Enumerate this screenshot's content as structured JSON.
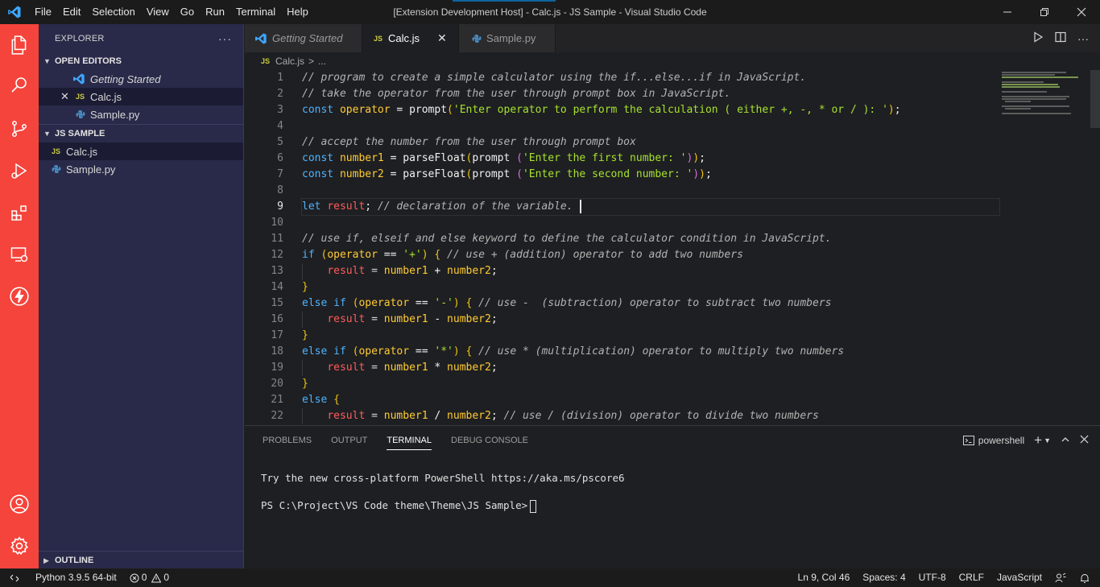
{
  "titlebar": {
    "title": "[Extension Development Host] - Calc.js - JS Sample - Visual Studio Code",
    "menu": [
      "File",
      "Edit",
      "Selection",
      "View",
      "Go",
      "Run",
      "Terminal",
      "Help"
    ]
  },
  "sidebar": {
    "title": "EXPLORER",
    "more": "···",
    "open_editors_label": "OPEN EDITORS",
    "open_editors": [
      {
        "label": "Getting Started",
        "icon": "vscode-icon"
      },
      {
        "label": "Calc.js",
        "icon": "js-icon",
        "badge": "JS"
      },
      {
        "label": "Sample.py",
        "icon": "python-icon"
      }
    ],
    "workspace_label": "JS SAMPLE",
    "files": [
      {
        "label": "Calc.js",
        "badge": "JS"
      },
      {
        "label": "Sample.py"
      }
    ],
    "outline_label": "OUTLINE"
  },
  "tabs": [
    {
      "label": "Getting Started"
    },
    {
      "label": "Calc.js",
      "badge": "JS",
      "close": "✕"
    },
    {
      "label": "Sample.py"
    }
  ],
  "breadcrumb": {
    "badge": "JS",
    "file": "Calc.js",
    "sep": ">",
    "rest": "..."
  },
  "editor": {
    "line_numbers": [
      "1",
      "2",
      "3",
      "4",
      "5",
      "6",
      "7",
      "8",
      "9",
      "10",
      "11",
      "12",
      "13",
      "14",
      "15",
      "16",
      "17",
      "18",
      "19",
      "20",
      "21",
      "22"
    ],
    "current_line": 9,
    "code": {
      "l1": "// program to create a simple calculator using the if...else...if in JavaScript.",
      "l2": "// take the operator from the user through prompt box in JavaScript.",
      "l3_kw": "const",
      "l3_var": "operator",
      "l3_eq": " = ",
      "l3_fn": "prompt",
      "l3_str": "'Enter operator to perform the calculation ( either +, -, * or / ): '",
      "l3_end": ";",
      "l5": "// accept the number from the user through prompt box",
      "l6_kw": "const",
      "l6_var": "number1",
      "l6_eq": " = ",
      "l6_fn": "parseFloat",
      "l6_fn2": "prompt ",
      "l6_str": "'Enter the first number: '",
      "l6_end": ";",
      "l7_kw": "const",
      "l7_var": "number2",
      "l7_eq": " = ",
      "l7_fn": "parseFloat",
      "l7_fn2": "prompt ",
      "l7_str": "'Enter the second number: '",
      "l7_end": ";",
      "l9_kw": "let",
      "l9_var": "result",
      "l9_rest": ";",
      "l9_com": " // declaration of the variable.",
      "l11": "// use if, elseif and else keyword to define the calculator condition in JavaScript.",
      "l12_kw": "if",
      "l12_var": "operator",
      "l12_op": " == ",
      "l12_str": "'+'",
      "l12_com": " // use + (addition) operator to add two numbers",
      "l13_res": "result",
      "l13_a": "number1",
      "l13_op": " + ",
      "l13_b": "number2",
      "l13_end": ";",
      "l15_kw": "else if",
      "l15_var": "operator",
      "l15_op": " == ",
      "l15_str": "'-'",
      "l15_com": " // use -  (subtraction) operator to subtract two numbers",
      "l16_res": "result",
      "l16_a": "number1",
      "l16_op": " - ",
      "l16_b": "number2",
      "l16_end": ";",
      "l18_kw": "else if",
      "l18_var": "operator",
      "l18_op": " == ",
      "l18_str": "'*'",
      "l18_com": " // use * (multiplication) operator to multiply two numbers",
      "l19_res": "result",
      "l19_a": "number1",
      "l19_op": " * ",
      "l19_b": "number2",
      "l19_end": ";",
      "l21_kw": "else",
      "l22_res": "result",
      "l22_a": "number1",
      "l22_op": " / ",
      "l22_b": "number2",
      "l22_end": ";",
      "l22_com": " // use / (division) operator to divide two numbers"
    }
  },
  "panel": {
    "tabs": [
      "PROBLEMS",
      "OUTPUT",
      "TERMINAL",
      "DEBUG CONSOLE"
    ],
    "active_tab": "TERMINAL",
    "shell": "powershell",
    "terminal_lines": [
      "Try the new cross-platform PowerShell https://aka.ms/pscore6",
      "PS C:\\Project\\VS Code theme\\Theme\\JS Sample>"
    ]
  },
  "statusbar": {
    "python": "Python 3.9.5 64-bit",
    "errors": "0",
    "warnings": "0",
    "position": "Ln 9, Col 46",
    "spaces": "Spaces: 4",
    "encoding": "UTF-8",
    "eol": "CRLF",
    "language": "JavaScript"
  },
  "colors": {
    "activity_bar": "#f5443b",
    "sidebar": "#292a49",
    "editor_bg": "#1e1f22",
    "keyword": "#4fb3ff",
    "variable": "#ffcc33",
    "string": "#a6e22e"
  }
}
